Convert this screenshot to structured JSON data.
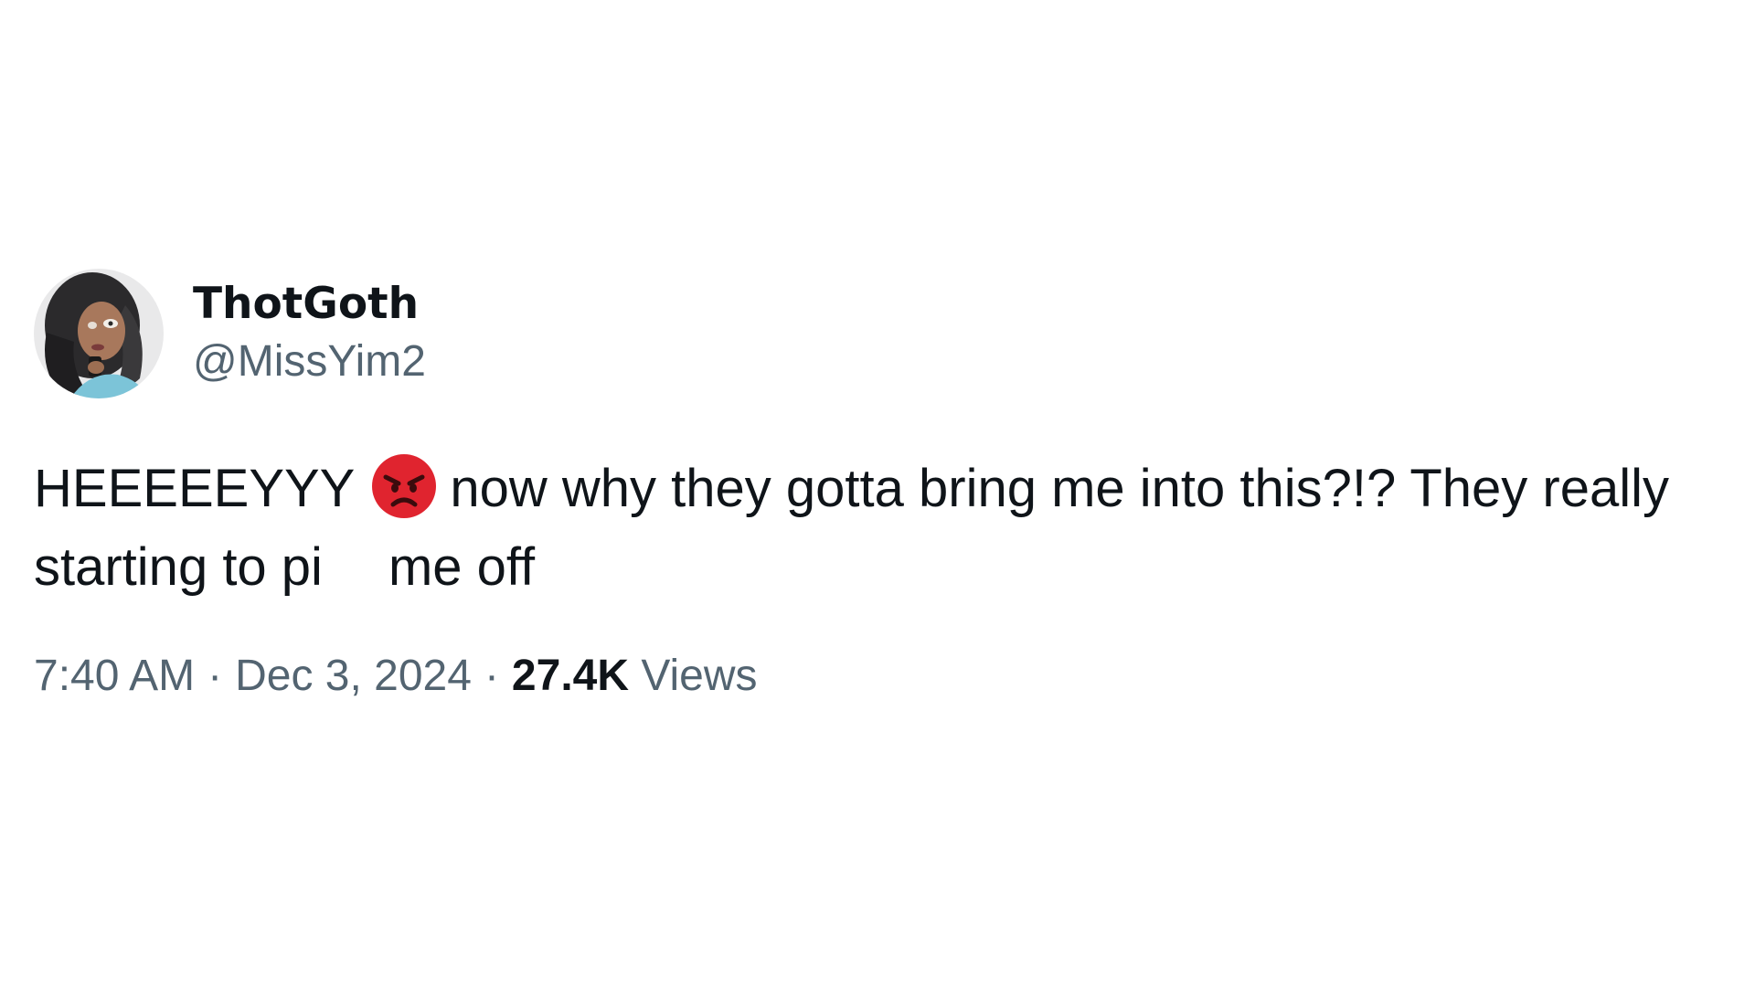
{
  "tweet": {
    "display_name": "ThotGoth",
    "handle": "@MissYim2",
    "text_part1": "HEEEEEYYY",
    "emoji": "angry-face",
    "text_part2": "now why they gotta bring me into this?!? They really starting to pi",
    "text_part3": "me off",
    "time": "7:40 AM",
    "date": "Dec 3, 2024",
    "separator": "·",
    "views_count": "27.4K",
    "views_label": "Views"
  },
  "colors": {
    "text_primary": "#0f1419",
    "text_secondary": "#536471",
    "emoji_red": "#e0242f",
    "background": "#ffffff"
  }
}
